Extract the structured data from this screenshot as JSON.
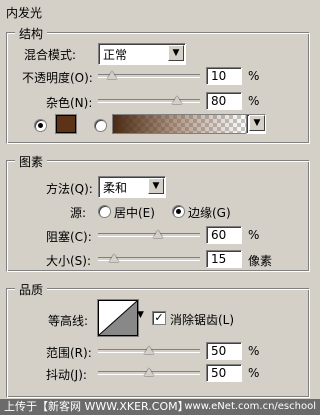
{
  "panel_title": "内发光",
  "structure": {
    "group_title": "结构",
    "blend_mode": {
      "label": "混合模式:",
      "value": "正常"
    },
    "opacity": {
      "label": "不透明度(O):",
      "value": "10",
      "unit": "%",
      "level": 0.1
    },
    "noise": {
      "label": "杂色(N):",
      "value": "80",
      "unit": "%",
      "level": 0.8
    },
    "color_swatch": "#5c3317"
  },
  "elements": {
    "group_title": "图素",
    "method": {
      "label": "方法(Q):",
      "value": "柔和"
    },
    "source": {
      "label": "源:",
      "center": "居中(E)",
      "edge": "边缘(G)"
    },
    "choke": {
      "label": "阻塞(C):",
      "value": "60",
      "unit": "%",
      "level": 0.6
    },
    "size": {
      "label": "大小(S):",
      "value": "15",
      "unit": "像素",
      "level": 0.12
    }
  },
  "quality": {
    "group_title": "品质",
    "contour": {
      "label": "等高线:"
    },
    "anti_alias": {
      "label": "消除锯齿(L)",
      "checkmark": "✓"
    },
    "range": {
      "label": "范围(R):",
      "value": "50",
      "unit": "%",
      "level": 0.5
    },
    "jitter": {
      "label": "抖动(J):",
      "value": "50",
      "unit": "%",
      "level": 0.5
    }
  },
  "footer": {
    "left": "上传于【新客网 WWW.XKER.COM】",
    "right": "www.eNet.com.cn/eschool"
  }
}
